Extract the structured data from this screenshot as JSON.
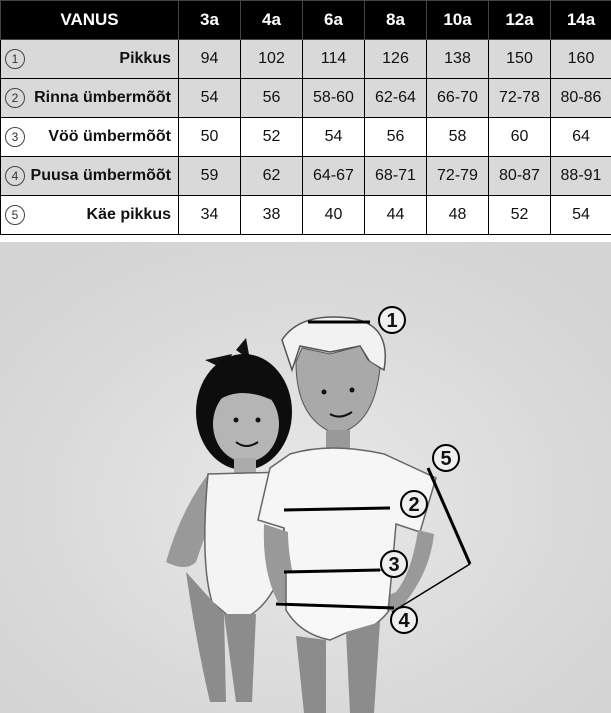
{
  "table": {
    "header_label": "VANUS",
    "ages": [
      "3a",
      "4a",
      "6a",
      "8a",
      "10a",
      "12a",
      "14a"
    ],
    "rows": [
      {
        "num": "1",
        "label": "Pikkus",
        "values": [
          "94",
          "102",
          "114",
          "126",
          "138",
          "150",
          "160"
        ]
      },
      {
        "num": "2",
        "label": "Rinna ümbermõõt",
        "values": [
          "54",
          "56",
          "58-60",
          "62-64",
          "66-70",
          "72-78",
          "80-86"
        ]
      },
      {
        "num": "3",
        "label": "Vöö ümbermõõt",
        "values": [
          "50",
          "52",
          "54",
          "56",
          "58",
          "60",
          "64"
        ]
      },
      {
        "num": "4",
        "label": "Puusa ümbermõõt",
        "values": [
          "59",
          "62",
          "64-67",
          "68-71",
          "72-79",
          "80-87",
          "88-91"
        ]
      },
      {
        "num": "5",
        "label": "Käe pikkus",
        "values": [
          "34",
          "38",
          "40",
          "44",
          "48",
          "52",
          "54"
        ]
      }
    ]
  },
  "illustration": {
    "callouts": [
      "1",
      "2",
      "3",
      "4",
      "5"
    ]
  }
}
